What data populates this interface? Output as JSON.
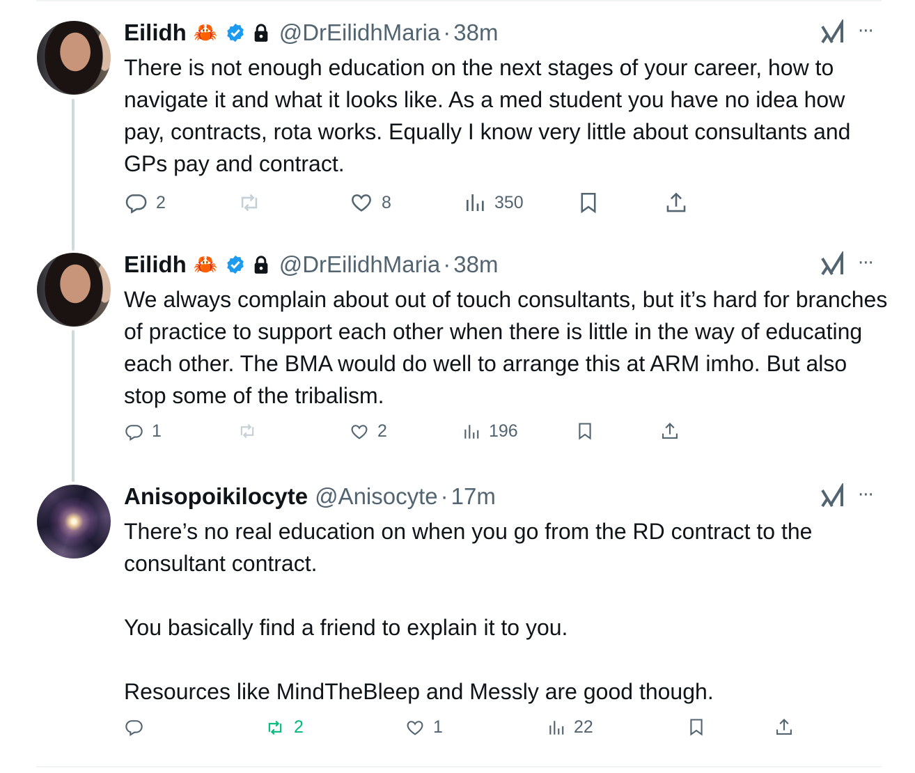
{
  "tweets": [
    {
      "name": "Eilidh",
      "emoji": "🦀",
      "handle": "@DrEilidhMaria",
      "dot": "·",
      "time": "38m",
      "text": [
        "There is not enough education on the next stages of your career, how to navigate it and what it looks like. As a med student you have no idea how pay, contracts, rota works. Equally I know very little about consultants and GPs pay and contract."
      ],
      "replies": "2",
      "retweets": "",
      "likes": "8",
      "views": "350"
    },
    {
      "name": "Eilidh",
      "emoji": "🦀",
      "handle": "@DrEilidhMaria",
      "dot": "·",
      "time": "38m",
      "text": [
        "We always complain about out of touch consultants, but it’s hard for branches of practice to support each other when there is little in the way of educating each other. The BMA would do well to arrange this at ARM imho. But also stop some of the tribalism."
      ],
      "replies": "1",
      "retweets": "",
      "likes": "2",
      "views": "196"
    },
    {
      "name": "Anisopoikilocyte",
      "handle": "@Anisocyte",
      "dot": "·",
      "time": "17m",
      "text": [
        "There’s no real education on when you go from the RD contract to the consultant contract.",
        "You basically find a friend to explain it to you.",
        "Resources like MindTheBleep and Messly are good though."
      ],
      "replies": "",
      "retweets": "2",
      "likes": "1",
      "views": "22"
    }
  ],
  "icons": {
    "more": "···",
    "grok": "grok-icon",
    "verified_color": "#1d9bf0",
    "retweeted_color": "#00ba7c"
  }
}
